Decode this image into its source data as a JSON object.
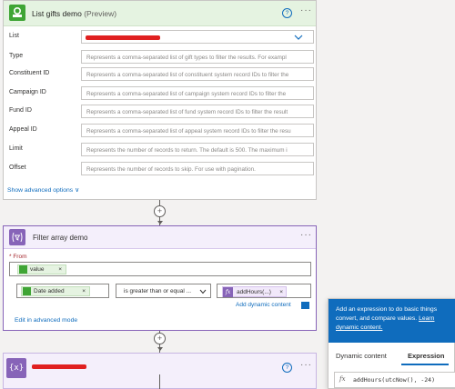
{
  "card1": {
    "title": "List gifts demo",
    "title_suffix": "(Preview)",
    "help": "?",
    "more": "···",
    "fields": [
      {
        "label": "List",
        "value": "",
        "placeholder": ""
      },
      {
        "label": "Type",
        "placeholder": "Represents a comma-separated list of gift types to filter the results. For exampl"
      },
      {
        "label": "Constituent ID",
        "placeholder": "Represents a comma-separated list of constituent system record IDs to filter the"
      },
      {
        "label": "Campaign ID",
        "placeholder": "Represents a comma-separated list of campaign system record IDs to filter the"
      },
      {
        "label": "Fund ID",
        "placeholder": "Represents a comma-separated list of fund system record IDs to filter the result"
      },
      {
        "label": "Appeal ID",
        "placeholder": "Represents a comma-separated list of appeal system record IDs to filter the resu"
      },
      {
        "label": "Limit",
        "placeholder": "Represents the number of records to return. The default is 500. The maximum i"
      },
      {
        "label": "Offset",
        "placeholder": "Represents the number of records to skip. For use with pagination."
      }
    ],
    "show_advanced": "Show advanced options",
    "chevron": "∨"
  },
  "connector": {
    "plus": "+"
  },
  "card2": {
    "title": "Filter array demo",
    "more": "···",
    "from_label": "* From",
    "from_token": "value",
    "left_token": "Date added",
    "operator": "is greater than or equal ...",
    "right_token": "addHours(...)",
    "add_dynamic": "Add dynamic content",
    "edit_advanced": "Edit in advanced mode"
  },
  "card3": {
    "help": "?",
    "more": "···"
  },
  "popup": {
    "text1": "Add an expression to do basic things",
    "text2_pre": "convert, and compare values.",
    "text2_link": "Learn",
    "text3_link": "dynamic content.",
    "tab_dynamic": "Dynamic content",
    "tab_expression": "Expression",
    "expression": "addHours(utcNow(), -24)"
  },
  "colors": {
    "accent_blue": "#0f6cbd",
    "brand_green": "#3fa535",
    "variable_purple": "#8764b8",
    "redaction": "#e02020"
  }
}
